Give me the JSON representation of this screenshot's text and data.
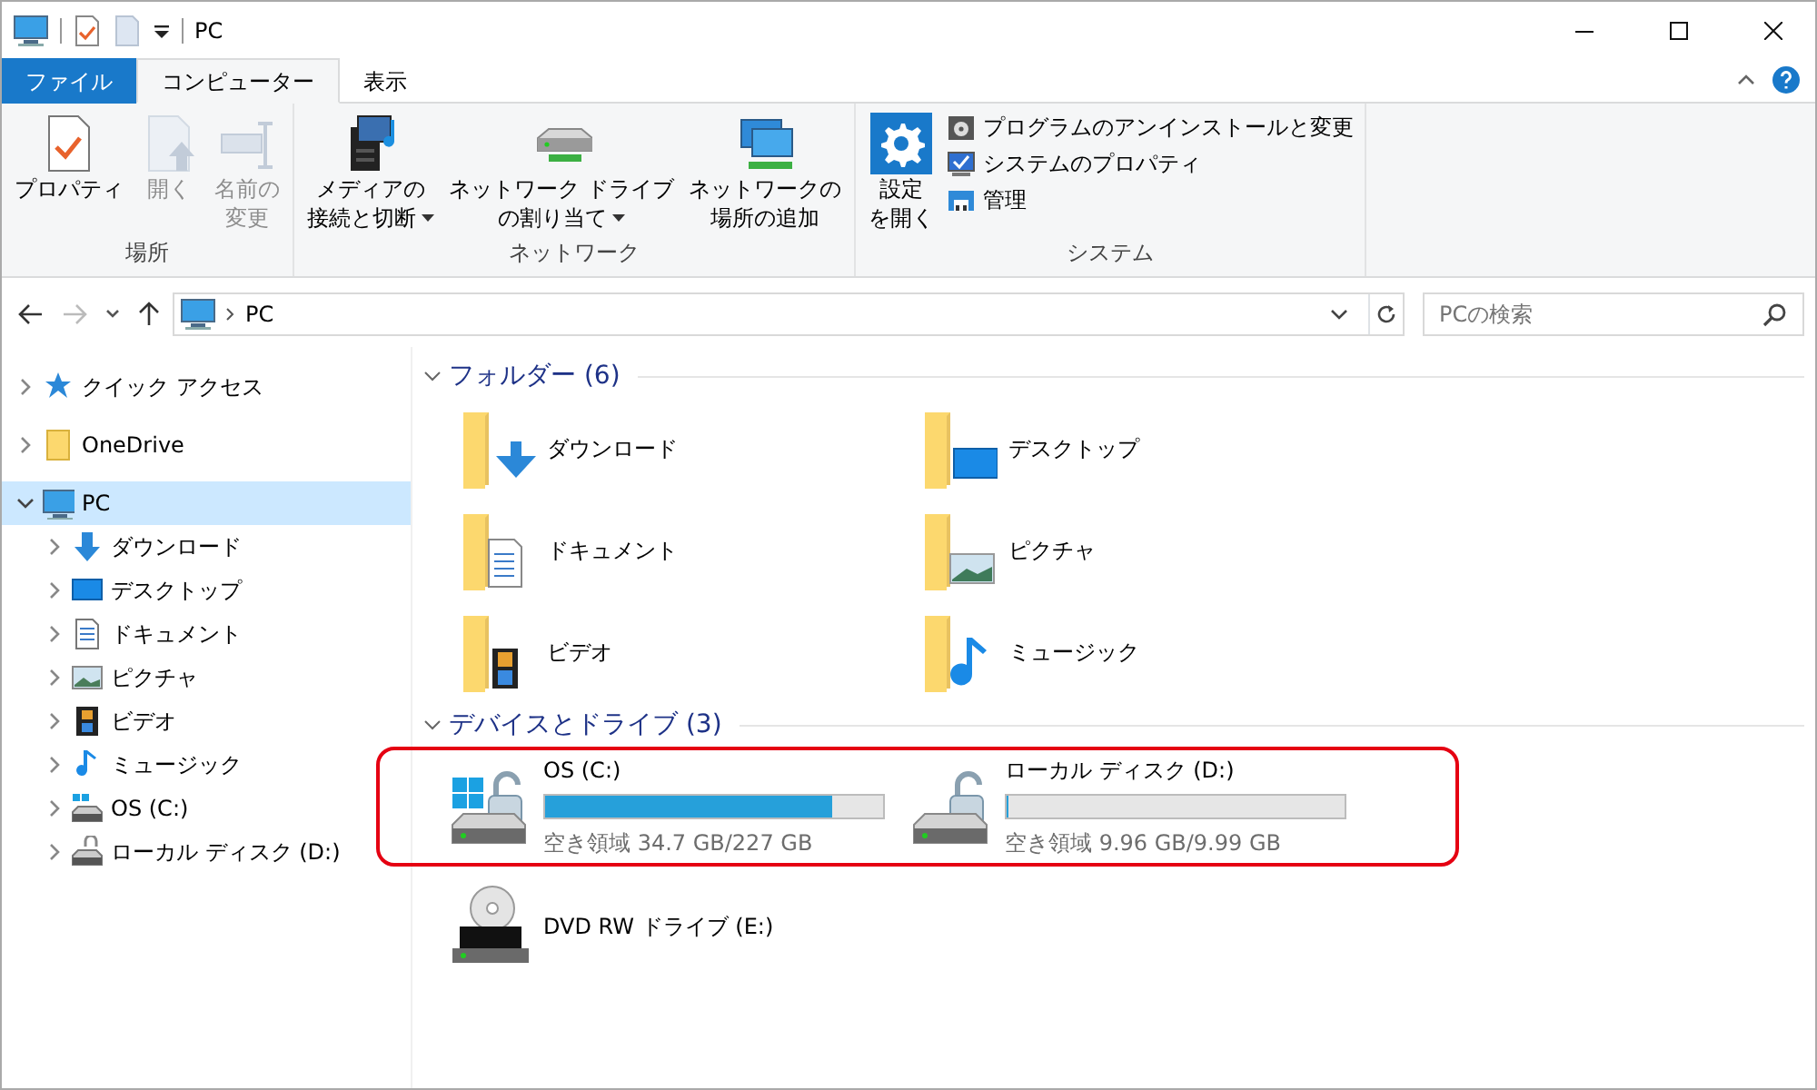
{
  "window": {
    "title": "PC"
  },
  "ribbon_tabs": [
    {
      "label": "ファイル",
      "kind": "file",
      "selected": false
    },
    {
      "label": "コンピューター",
      "kind": "tab",
      "selected": true
    },
    {
      "label": "表示",
      "kind": "tab",
      "selected": false
    }
  ],
  "ribbon_groups": [
    {
      "label": "場所",
      "items": [
        {
          "lines": [
            "プロパティ"
          ],
          "kind": "large",
          "disabled": false
        },
        {
          "lines": [
            "開く"
          ],
          "kind": "large",
          "disabled": true
        },
        {
          "lines": [
            "名前の",
            "変更"
          ],
          "kind": "large",
          "disabled": true
        }
      ]
    },
    {
      "label": "ネットワーク",
      "items": [
        {
          "lines": [
            "メディアの",
            "接続と切断"
          ],
          "kind": "large",
          "disabled": false,
          "dropdown": true
        },
        {
          "lines": [
            "ネットワーク ドライブ",
            "の割り当て"
          ],
          "kind": "large",
          "disabled": false,
          "dropdown": true
        },
        {
          "lines": [
            "ネットワークの",
            "場所の追加"
          ],
          "kind": "large",
          "disabled": false
        }
      ]
    },
    {
      "label": "システム",
      "items": [
        {
          "lines": [
            "設定",
            "を開く"
          ],
          "kind": "large",
          "disabled": false
        },
        {
          "lines": [
            "プログラムのアンインストールと変更"
          ],
          "kind": "small",
          "disabled": false
        },
        {
          "lines": [
            "システムのプロパティ"
          ],
          "kind": "small",
          "disabled": false
        },
        {
          "lines": [
            "管理"
          ],
          "kind": "small",
          "disabled": false
        }
      ]
    }
  ],
  "address_bar": {
    "path": "PC",
    "forward_disabled": true
  },
  "search": {
    "placeholder": "PCの検索"
  },
  "navigation": [
    {
      "label": "クイック アクセス",
      "expanded": false,
      "selected": false
    },
    {
      "label": "OneDrive",
      "expanded": false,
      "selected": false
    },
    {
      "label": "PC",
      "expanded": true,
      "selected": true,
      "children": [
        {
          "label": "ダウンロード",
          "expanded": false,
          "selected": false
        },
        {
          "label": "デスクトップ",
          "expanded": false,
          "selected": false
        },
        {
          "label": "ドキュメント",
          "expanded": false,
          "selected": false
        },
        {
          "label": "ピクチャ",
          "expanded": false,
          "selected": false
        },
        {
          "label": "ビデオ",
          "expanded": false,
          "selected": false
        },
        {
          "label": "ミュージック",
          "expanded": false,
          "selected": false
        },
        {
          "label": "OS (C:)",
          "expanded": false,
          "selected": false
        },
        {
          "label": "ローカル ディスク (D:)",
          "expanded": false,
          "selected": false
        }
      ]
    }
  ],
  "folders": {
    "title": "フォルダー (6)",
    "expanded": true,
    "items": [
      {
        "name": "ダウンロード"
      },
      {
        "name": "デスクトップ"
      },
      {
        "name": "ドキュメント"
      },
      {
        "name": "ピクチャ"
      },
      {
        "name": "ビデオ"
      },
      {
        "name": "ミュージック"
      }
    ]
  },
  "devices": {
    "title": "デバイスとドライブ (3)",
    "expanded": true,
    "rows": [
      {
        "highlighted": true,
        "items": [
          {
            "name": "OS (C:)",
            "kind": "drive",
            "level": 0.847,
            "free": "空き領域 34.7 GB/227 GB"
          },
          {
            "name": "ローカル ディスク (D:)",
            "kind": "drive",
            "level": 0.003,
            "free": "空き領域 9.96 GB/9.99 GB"
          }
        ]
      },
      {
        "highlighted": false,
        "items": [
          {
            "name": "DVD RW ドライブ (E:)",
            "kind": "dvd"
          }
        ]
      }
    ]
  }
}
